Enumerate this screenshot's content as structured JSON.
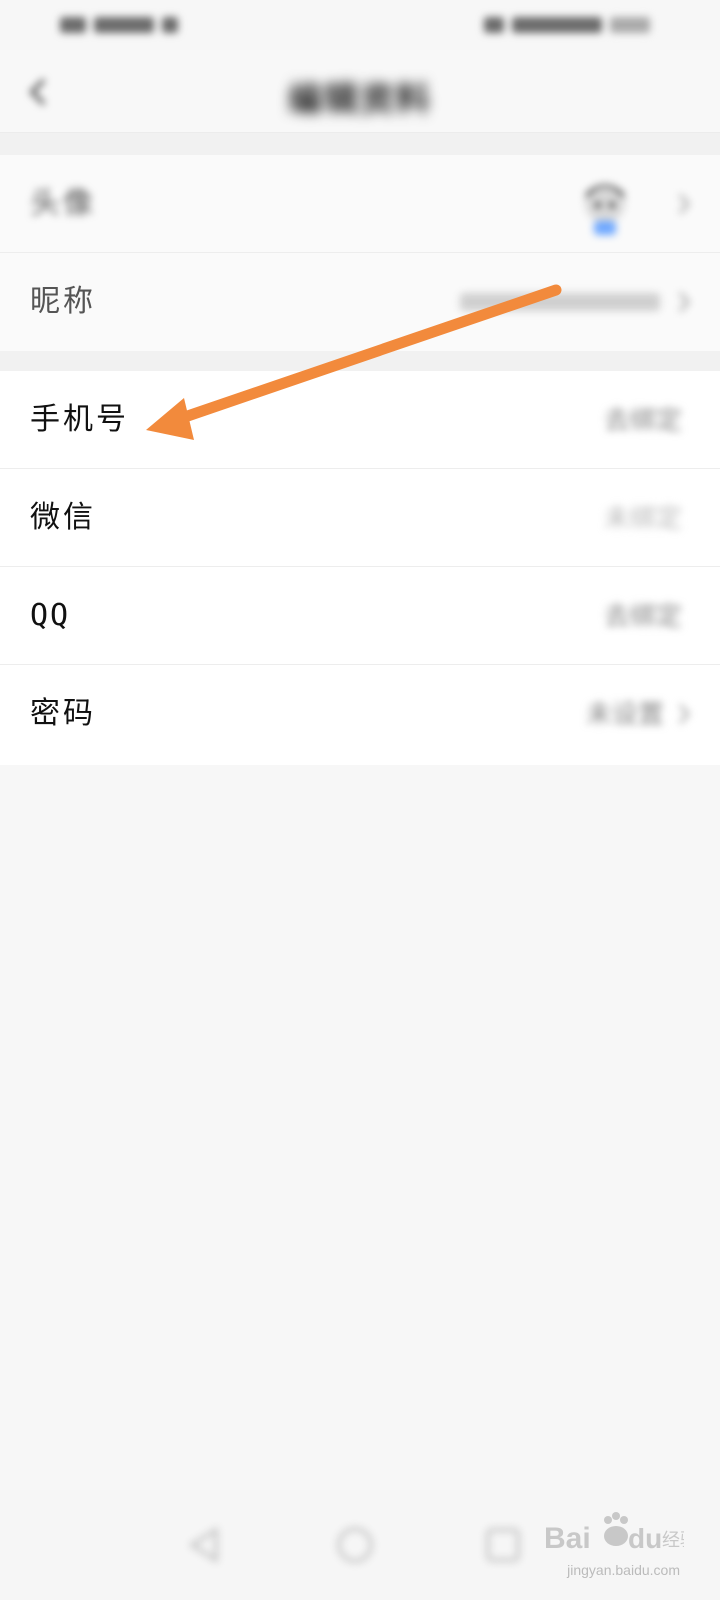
{
  "status_bar": {
    "carrier": "",
    "time": ""
  },
  "header": {
    "title": "编辑资料"
  },
  "profile": {
    "avatar_label": "头像",
    "nickname_label": "昵称",
    "nickname_value": ""
  },
  "accounts": {
    "items": [
      {
        "label": "手机号",
        "value": "去绑定"
      },
      {
        "label": "微信",
        "value": "未绑定"
      },
      {
        "label": "QQ",
        "value": "去绑定"
      },
      {
        "label": "密码",
        "value": "未设置"
      }
    ]
  },
  "annotation": {
    "color": "#f28a3c"
  },
  "watermark": {
    "brand": "Baidu经验",
    "url": "jingyan.baidu.com"
  },
  "colors": {
    "background": "#f7f7f7",
    "row": "#ffffff",
    "arrow": "#f28a3c"
  }
}
